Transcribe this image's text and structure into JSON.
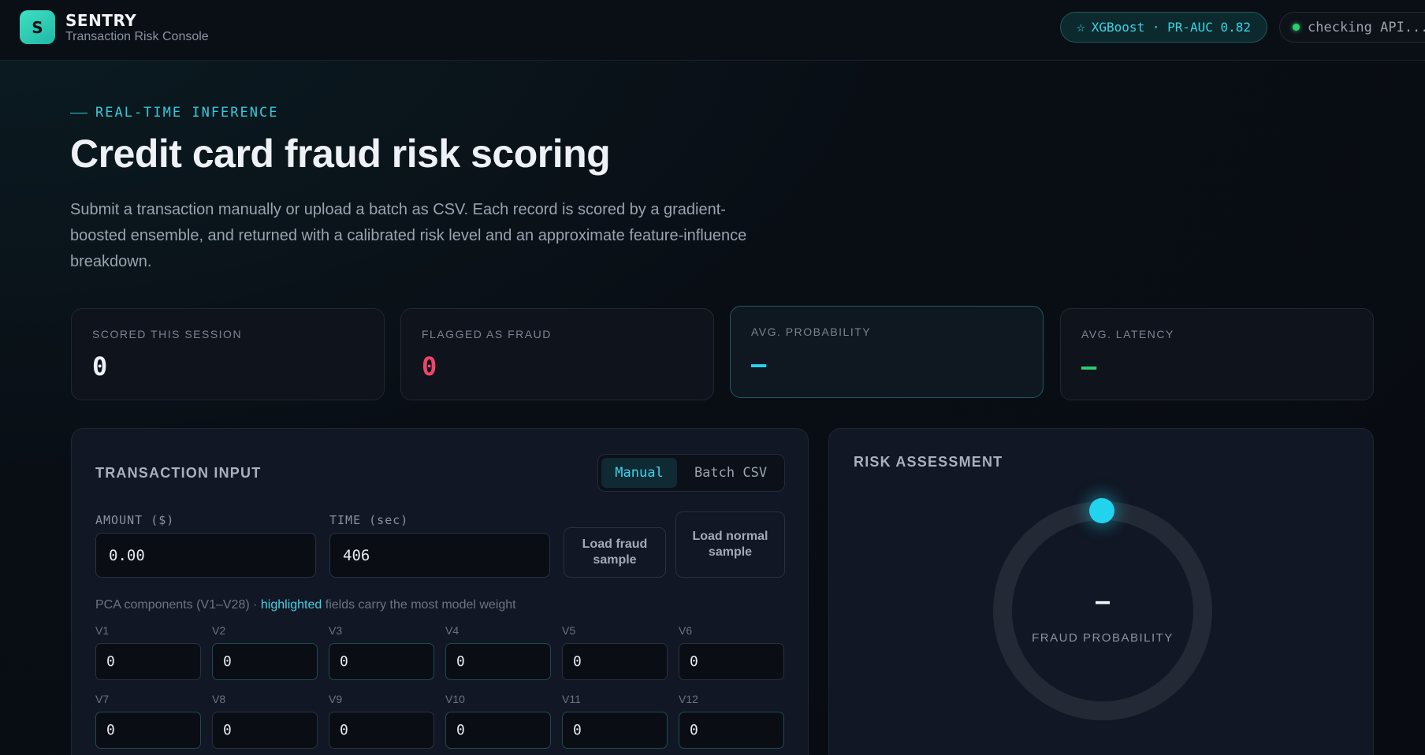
{
  "header": {
    "logo_letter": "S",
    "brand_name": "SENTRY",
    "brand_subtitle": "Transaction Risk Console",
    "model_badge": "XGBoost · PR-AUC 0.82",
    "api_status": "checking API..."
  },
  "hero": {
    "eyebrow": "REAL-TIME INFERENCE",
    "title": "Credit card fraud risk scoring",
    "description": "Submit a transaction manually or upload a batch as CSV. Each record is scored by a gradient-boosted ensemble, and returned with a calibrated risk level and an approximate feature-influence breakdown."
  },
  "stats": [
    {
      "label": "SCORED THIS SESSION",
      "value": "0",
      "color": "#eef1f5"
    },
    {
      "label": "FLAGGED AS FRAUD",
      "value": "0",
      "color": "#f0446a"
    },
    {
      "label": "AVG. PROBABILITY",
      "value": "—",
      "color": "#22d3ee"
    },
    {
      "label": "AVG. LATENCY",
      "value": "—",
      "color": "#2ecc71"
    }
  ],
  "input_panel": {
    "title": "TRANSACTION INPUT",
    "tabs": [
      "Manual",
      "Batch CSV"
    ],
    "active_tab": "Manual",
    "amount_label": "AMOUNT ($)",
    "amount_value": "0.00",
    "time_label": "TIME (sec)",
    "time_value": "406",
    "load_fraud_label": "Load fraud sample",
    "load_normal_label": "Load normal sample",
    "pca_note_prefix": "PCA components (V1–V28) · ",
    "pca_note_highlight": "highlighted",
    "pca_note_suffix": " fields carry the most model weight",
    "components": [
      {
        "label": "V1",
        "value": "0",
        "highlighted": false
      },
      {
        "label": "V2",
        "value": "0",
        "highlighted": true
      },
      {
        "label": "V3",
        "value": "0",
        "highlighted": true
      },
      {
        "label": "V4",
        "value": "0",
        "highlighted": true
      },
      {
        "label": "V5",
        "value": "0",
        "highlighted": false
      },
      {
        "label": "V6",
        "value": "0",
        "highlighted": false
      },
      {
        "label": "V7",
        "value": "0",
        "highlighted": true
      },
      {
        "label": "V8",
        "value": "0",
        "highlighted": false
      },
      {
        "label": "V9",
        "value": "0",
        "highlighted": false
      },
      {
        "label": "V10",
        "value": "0",
        "highlighted": true
      },
      {
        "label": "V11",
        "value": "0",
        "highlighted": true
      },
      {
        "label": "V12",
        "value": "0",
        "highlighted": true
      }
    ]
  },
  "risk_panel": {
    "title": "RISK ASSESSMENT",
    "probability_value": "–",
    "probability_caption": "FRAUD PROBABILITY"
  }
}
